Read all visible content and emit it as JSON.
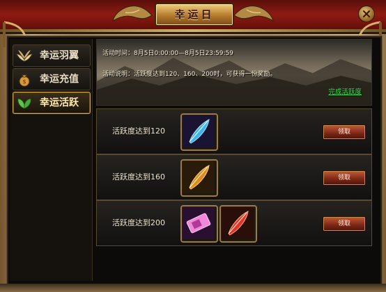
{
  "window": {
    "title": "幸运日"
  },
  "tabs": [
    {
      "label": "幸运羽翼",
      "icon": "wing-icon",
      "active": false
    },
    {
      "label": "幸运充值",
      "icon": "money-bag-icon",
      "active": false
    },
    {
      "label": "幸运活跃",
      "icon": "leaf-icon",
      "active": true
    }
  ],
  "info": {
    "time_text": "活动时间：8月5日0:00:00—8月5日23:59:59",
    "desc_text": "活动说明：活跃度达到120、160、200时，可获得一份奖励。",
    "link_text": "完成活跃度"
  },
  "rewards": [
    {
      "requirement": "活跃度达到120",
      "items": [
        "blue-feather-icon"
      ],
      "button": "领取"
    },
    {
      "requirement": "活跃度达到160",
      "items": [
        "orange-feather-icon"
      ],
      "button": "领取"
    },
    {
      "requirement": "活跃度达到200",
      "items": [
        "pink-ticket-icon",
        "red-feather-icon"
      ],
      "button": "领取"
    }
  ],
  "colors": {
    "accent_gold": "#d6a747",
    "title_bar_red": "#8e1b13",
    "link_green": "#39e24c",
    "button_red": "#7c2615"
  }
}
